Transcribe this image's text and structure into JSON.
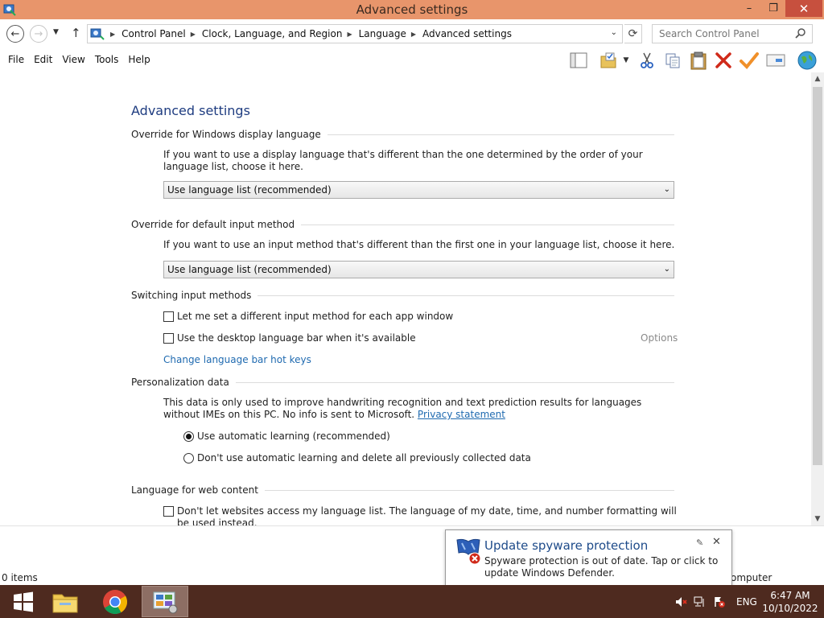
{
  "window": {
    "title": "Advanced settings",
    "minimize": "–",
    "maximize": "❐",
    "close": "✕"
  },
  "address": {
    "back": "←",
    "forward": "→",
    "history": "▼",
    "up": "↑",
    "breadcrumbs": [
      "Control Panel",
      "Clock, Language, and Region",
      "Language",
      "Advanced settings"
    ],
    "crumb_separator": "▶",
    "dropdown": "⌄",
    "refresh": "⟳",
    "search_placeholder": "Search Control Panel"
  },
  "menu": [
    "File",
    "Edit",
    "View",
    "Tools",
    "Help"
  ],
  "toolbar_icons": [
    "layout-icon",
    "properties-icon",
    "cut-icon",
    "copy-icon",
    "paste-icon",
    "delete-icon",
    "check-icon",
    "rename-icon",
    "globe-icon"
  ],
  "content": {
    "page_title": "Advanced settings",
    "display_language": {
      "heading": "Override for Windows display language",
      "description": "If you want to use a display language that's different than the one determined by the order of your language list, choose it here.",
      "selected": "Use language list (recommended)"
    },
    "input_method": {
      "heading": "Override for default input method",
      "description": "If you want to use an input method that's different than the first one in your language list, choose it here.",
      "selected": "Use language list (recommended)"
    },
    "switching": {
      "heading": "Switching input methods",
      "option1": "Let me set a different input method for each app window",
      "option2": "Use the desktop language bar when it's available",
      "options_link": "Options",
      "hotkeys_link": "Change language bar hot keys"
    },
    "personalization": {
      "heading": "Personalization data",
      "description": "This data is only used to improve handwriting recognition and text prediction results for languages without IMEs on this PC. No info is sent to Microsoft.",
      "privacy_link": "Privacy statement",
      "radio1": "Use automatic learning (recommended)",
      "radio2": "Don't use automatic learning and delete all previously collected data",
      "selected": "radio1"
    },
    "web_content": {
      "heading": "Language for web content",
      "option": "Don't let websites access my language list. The language of my date, time, and number formatting will be used instead."
    }
  },
  "status": {
    "items": "0 items",
    "right": "omputer"
  },
  "notification": {
    "title": "Update spyware protection",
    "body": "Spyware protection is out of date. Tap or click to update Windows Defender.",
    "close": "✕"
  },
  "taskbar": {
    "language": "ENG",
    "time": "6:47 AM",
    "date": "10/10/2022"
  },
  "colors": {
    "titlebar": "#e8956b",
    "close_button": "#c7503e",
    "taskbar": "#4e2a1f",
    "link": "#1f6ab0",
    "heading_blue": "#1e3c80"
  }
}
